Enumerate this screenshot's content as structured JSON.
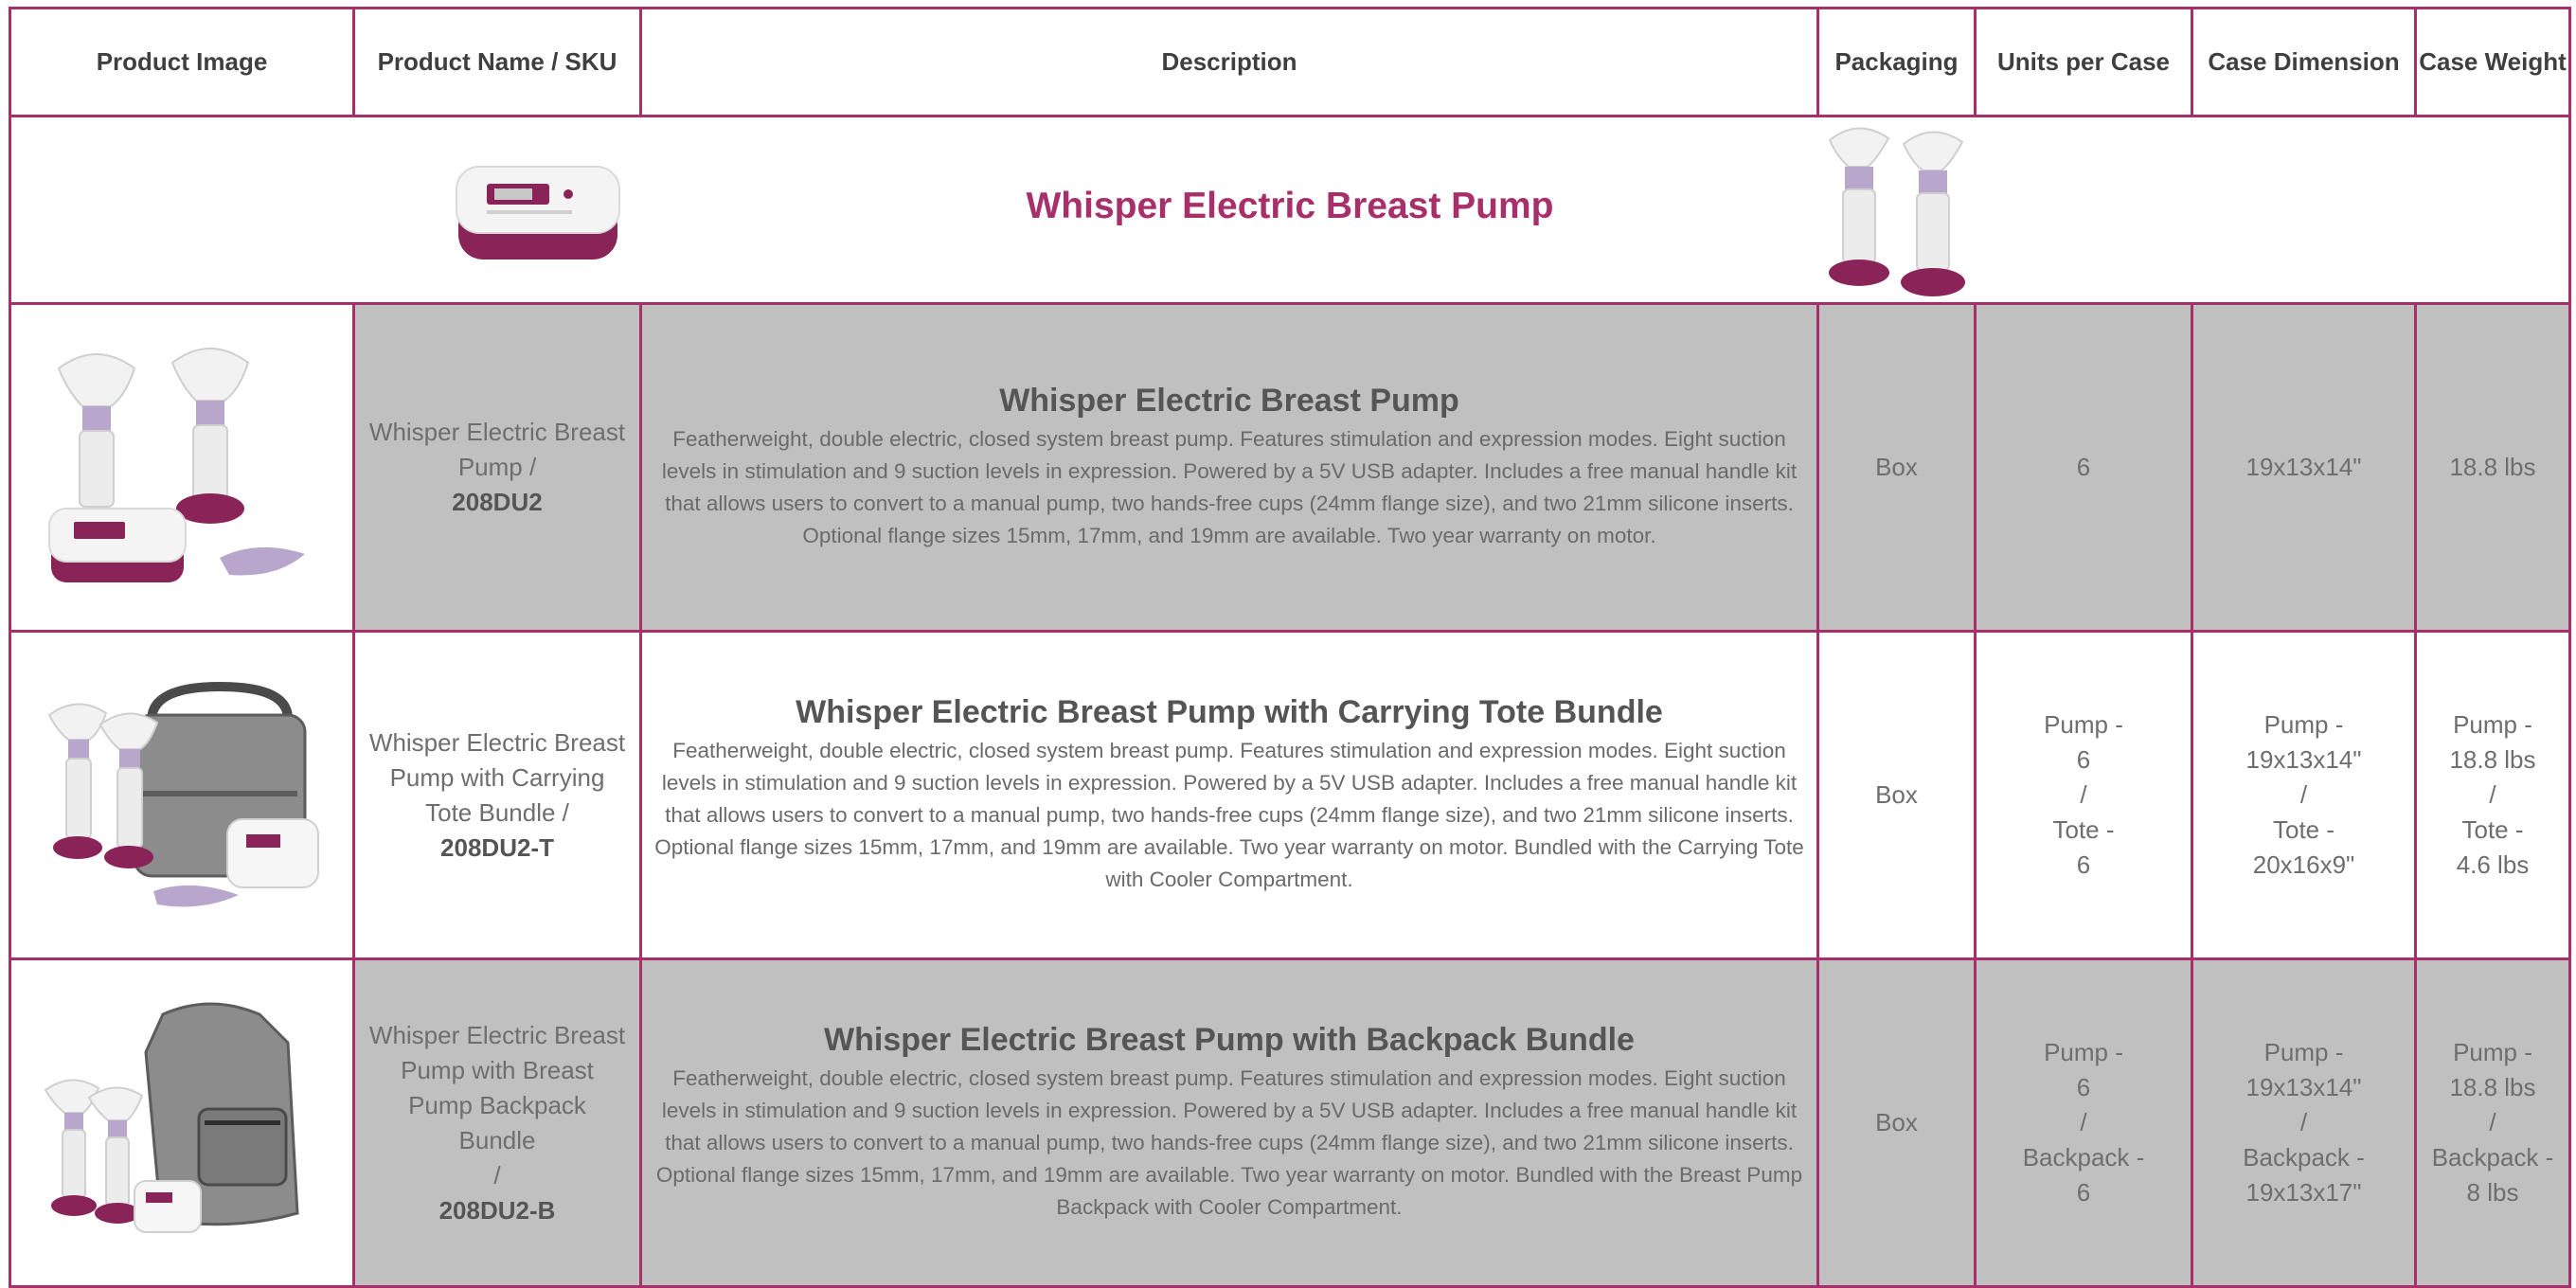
{
  "headers": [
    "Product Image",
    "Product Name / SKU",
    "Description",
    "Packaging",
    "Units per Case",
    "Case Dimension",
    "Case Weight"
  ],
  "banner": {
    "title": "Whisper Electric Breast Pump"
  },
  "rows": [
    {
      "name": "Whisper Electric Breast Pump /",
      "sku": "208DU2",
      "title": "Whisper Electric Breast Pump",
      "description": "Featherweight, double electric, closed system breast pump. Features stimulation and expression modes. Eight suction levels in stimulation and 9 suction levels in expression. Powered by a 5V USB adapter. Includes  a free manual handle kit that allows users to convert to a manual pump, two hands-free cups (24mm flange size), and two 21mm silicone inserts. Optional flange sizes 15mm, 17mm, and 19mm are available. Two year warranty on motor.",
      "packaging": "Box",
      "units": "6",
      "dimension": "19x13x14\"",
      "weight": "18.8 lbs"
    },
    {
      "name": "Whisper Electric Breast Pump with Carrying Tote Bundle /",
      "sku": "208DU2-T",
      "title": "Whisper Electric Breast Pump with Carrying Tote Bundle",
      "description": "Featherweight, double electric, closed system breast pump. Features stimulation and expression modes. Eight suction levels in stimulation and 9 suction levels in expression. Powered by a 5V USB adapter. Includes  a free manual handle kit that allows users to convert to a manual pump, two hands-free cups (24mm flange size), and two 21mm silicone inserts. Optional flange sizes 15mm, 17mm, and 19mm are available. Two year warranty on motor. Bundled with the Carrying Tote with Cooler Compartment.",
      "packaging": "Box",
      "units": [
        "Pump -",
        "6",
        "/",
        "Tote -",
        "6"
      ],
      "dimension": [
        "Pump -",
        "19x13x14\"",
        "/",
        "Tote -",
        "20x16x9\""
      ],
      "weight": [
        "Pump -",
        "18.8 lbs",
        "/",
        "Tote -",
        "4.6 lbs"
      ]
    },
    {
      "name": "Whisper Electric Breast Pump with Breast Pump Backpack Bundle",
      "name_sep": "/",
      "sku": "208DU2-B",
      "title": "Whisper Electric Breast Pump with Backpack Bundle",
      "description": "Featherweight, double electric, closed system breast pump. Features stimulation and expression modes. Eight suction levels in stimulation and 9 suction levels in expression. Powered by a 5V USB adapter. Includes  a free manual handle kit that allows users to convert to a manual pump, two hands-free cups (24mm flange size), and two 21mm silicone inserts. Optional flange sizes 15mm, 17mm, and 19mm are available. Two year warranty on motor. Bundled with the Breast Pump Backpack with Cooler Compartment.",
      "packaging": "Box",
      "units": [
        "Pump -",
        "6",
        "/",
        "Backpack -",
        "6"
      ],
      "dimension": [
        "Pump -",
        "19x13x14\"",
        "/",
        "Backpack -",
        "19x13x17\""
      ],
      "weight": [
        "Pump -",
        "18.8 lbs",
        "/",
        "Backpack -",
        "8 lbs"
      ]
    }
  ],
  "colors": {
    "border": "#a8306a",
    "brand": "#a8306a",
    "row_tint": "#c0c0c0"
  }
}
